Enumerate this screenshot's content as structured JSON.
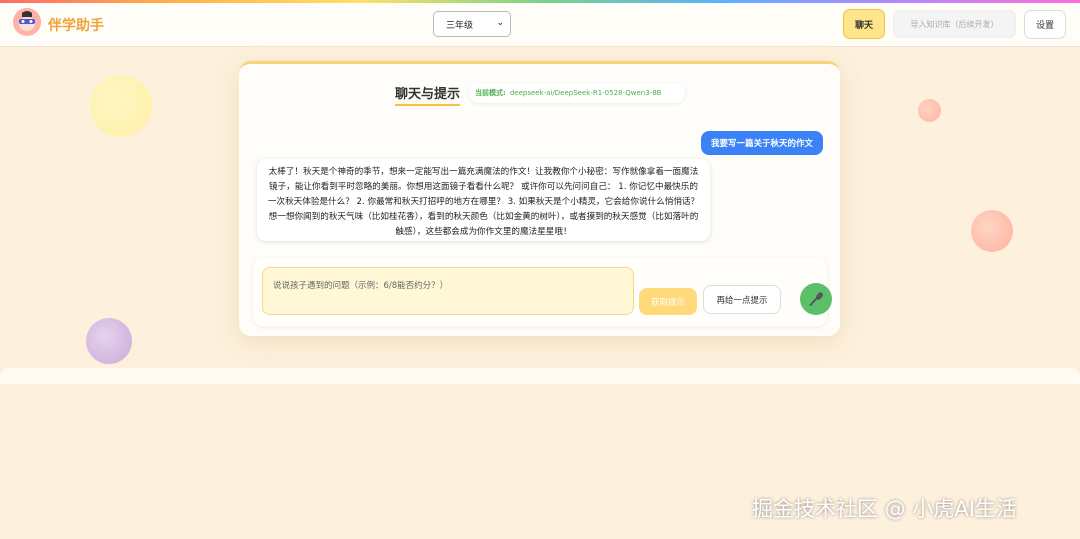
{
  "header": {
    "app_title": "伴学助手",
    "grade_select": "三年级",
    "chat_button": "聊天",
    "import_button": "导入知识库（后续开发）",
    "settings_button": "设置"
  },
  "colors": {
    "accent": "#f3c33a",
    "title": "#f0a33a",
    "user_bubble": "#3b82f6",
    "model_text": "#4caf50",
    "mic": "#5cbf6a"
  },
  "chat": {
    "title": "聊天与提示",
    "model_label": "当前模式:",
    "model_name": "deepseek-ai/DeepSeek-R1-0528-Qwen3-8B",
    "user_message": "我要写一篇关于秋天的作文",
    "bot_message": "太棒了！秋天是个神奇的季节，想来一定能写出一篇充满魔法的作文！让我教你个小秘密：写作就像拿着一面魔法镜子，能让你看到平时忽略的美丽。你想用这面镜子看看什么呢？ 或许你可以先问问自己： 1. 你记忆中最快乐的一次秋天体验是什么？ 2. 你最常和秋天打招呼的地方在哪里？ 3. 如果秋天是个小精灵，它会给你说什么悄悄话？ 想一想你闻到的秋天气味（比如桂花香），看到的秋天颜色（比如金黄的树叶），或者摸到的秋天感觉（比如落叶的触感），这些都会成为你作文里的魔法星星哦！"
  },
  "input": {
    "placeholder": "说说孩子遇到的问题（示例：6/8能否约分？）",
    "get_hint_button": "获取提示",
    "more_hint_button": "再给一点提示",
    "mic_icon": "microphone-icon"
  },
  "watermark": "掘金技术社区 @ 小虎AI生活"
}
